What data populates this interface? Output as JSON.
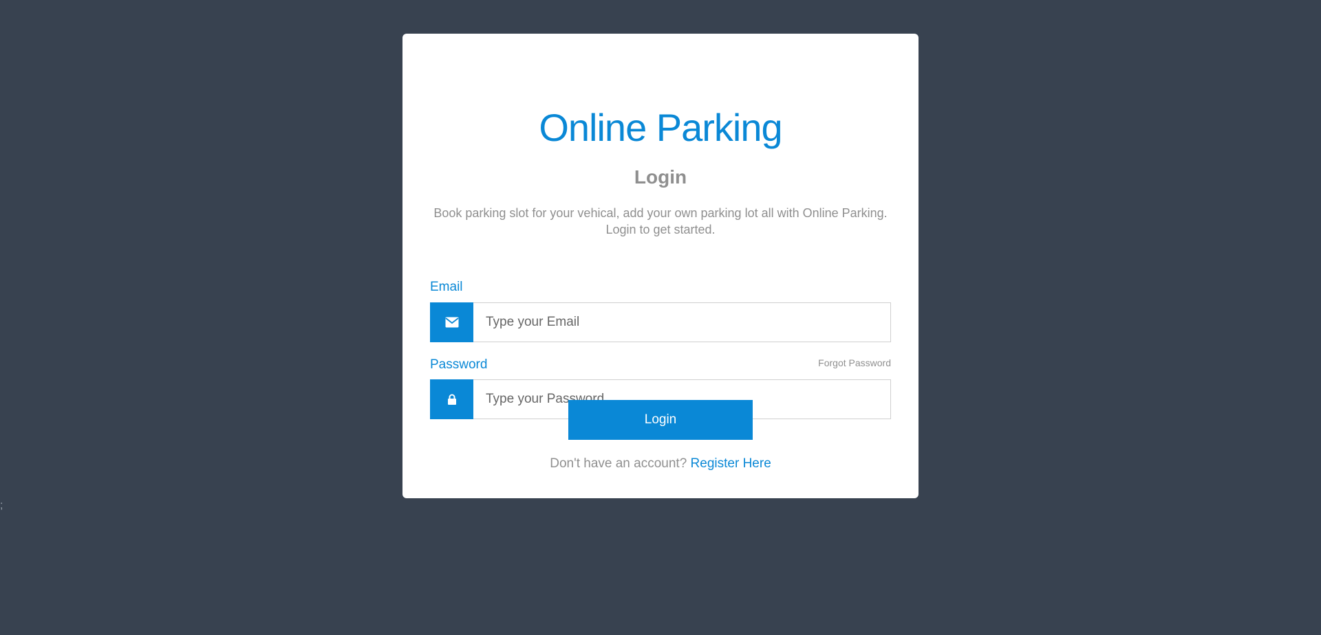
{
  "brand": "Online Parking",
  "subtitle": "Login",
  "description": "Book parking slot for your vehical, add your own parking lot all with Online Parking. Login to get started.",
  "form": {
    "email_label": "Email",
    "email_placeholder": "Type your Email",
    "password_label": "Password",
    "password_placeholder": "Type your Password",
    "forgot_label": "Forgot Password",
    "submit_label": "Login"
  },
  "footer": {
    "prompt": "Don't have an account?",
    "register_label": "Register Here"
  },
  "stray_text": ";",
  "icons": {
    "email": "envelope-icon",
    "password": "lock-icon"
  },
  "colors": {
    "accent": "#0a88d6",
    "background": "#384250",
    "muted_text": "#8f8f8f"
  }
}
